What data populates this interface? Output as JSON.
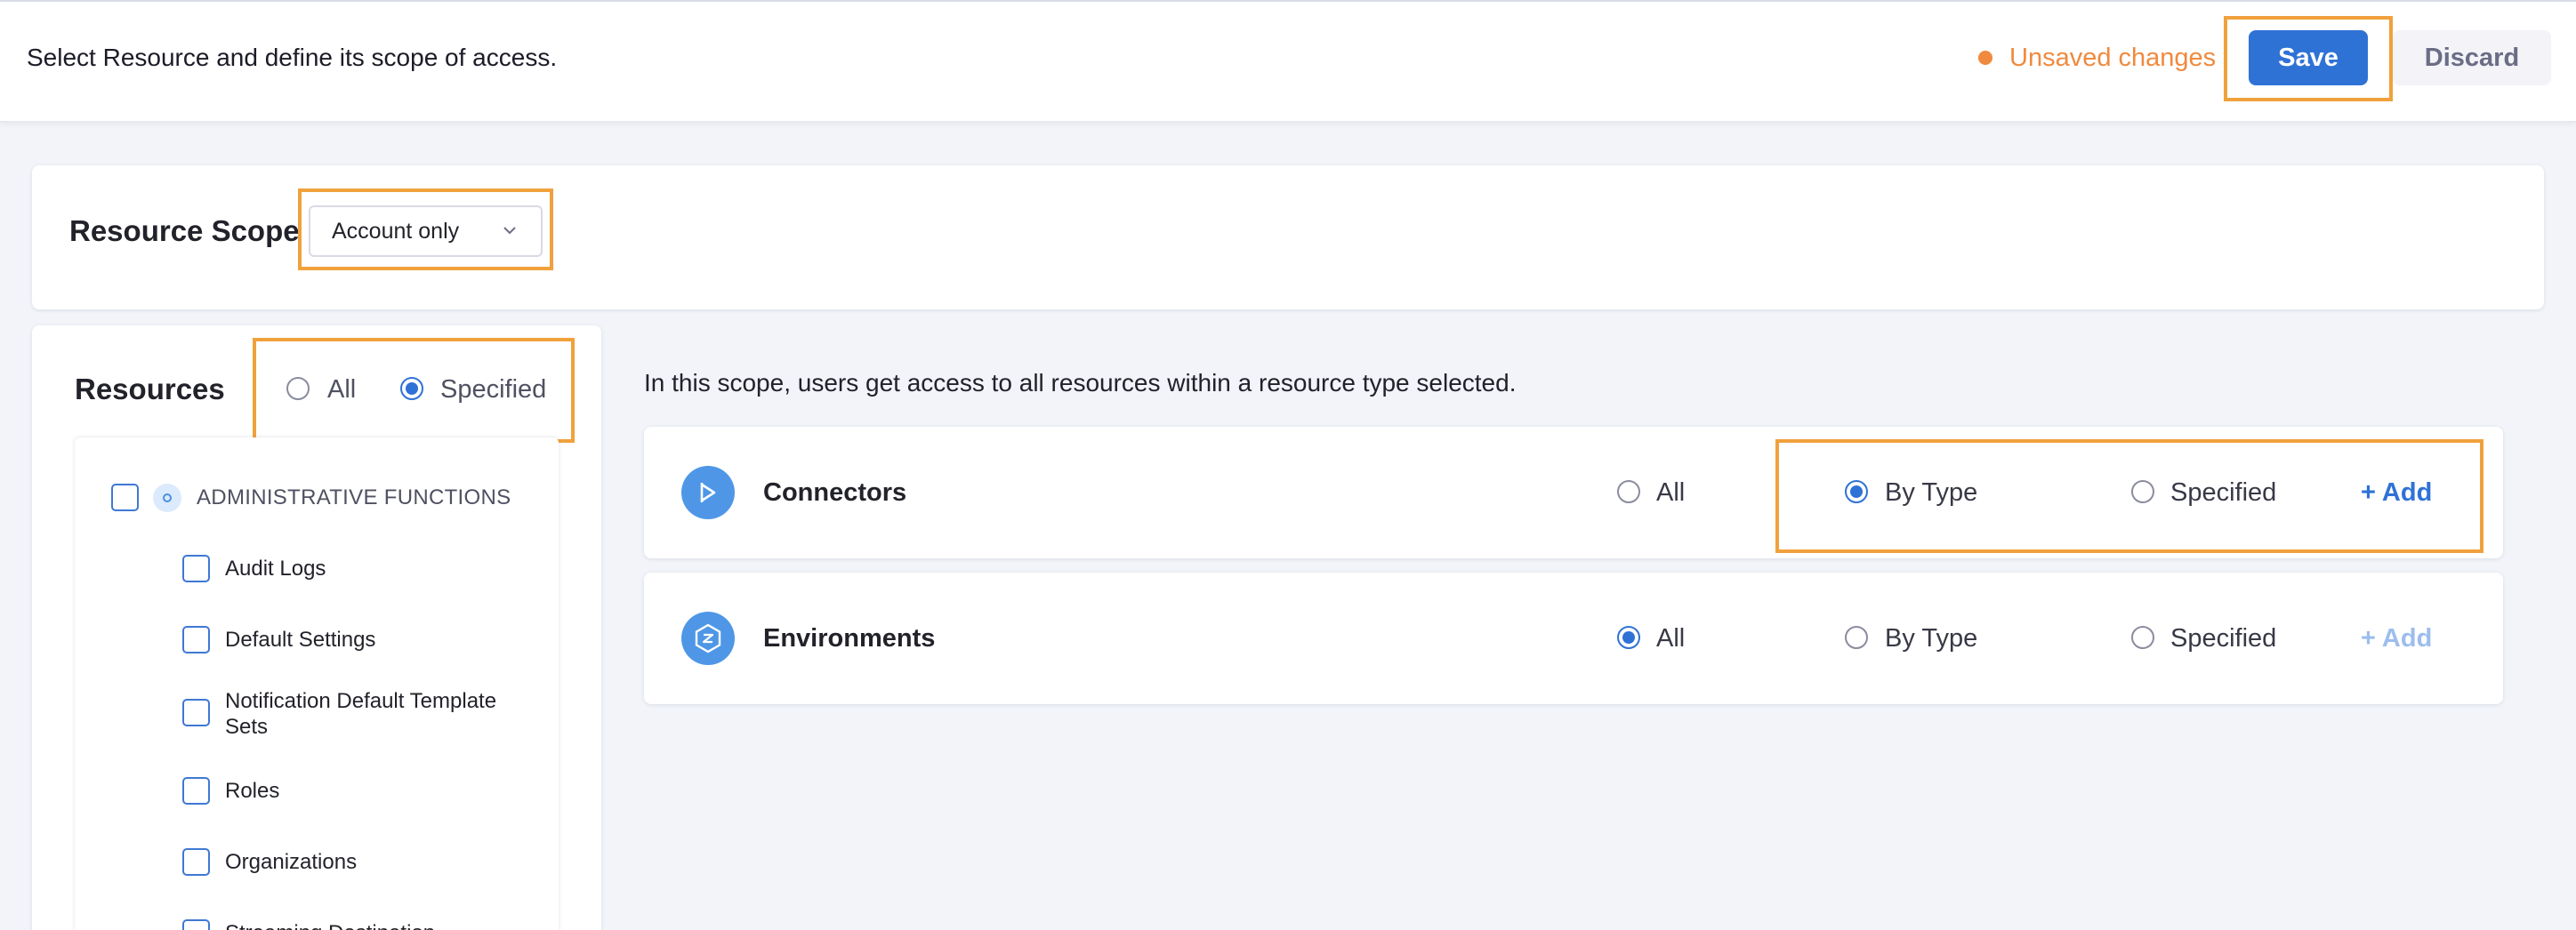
{
  "topbar": {
    "description": "Select Resource and define its scope of access.",
    "unsaved_label": "Unsaved changes",
    "save_label": "Save",
    "discard_label": "Discard"
  },
  "resource_scope": {
    "title": "Resource Scope",
    "selected": "Account only"
  },
  "resources": {
    "title": "Resources",
    "mode_options": [
      "All",
      "Specified"
    ],
    "selected_mode": "Specified",
    "tree": {
      "group_label": "ADMINISTRATIVE FUNCTIONS",
      "items": [
        {
          "label": "Audit Logs"
        },
        {
          "label": "Default Settings"
        },
        {
          "label": "Notification Default Template Sets"
        },
        {
          "label": "Roles"
        },
        {
          "label": "Organizations"
        },
        {
          "label": "Streaming Destination"
        }
      ]
    }
  },
  "scope_info": "In this scope, users get access to all resources within a resource type selected.",
  "resource_rows": [
    {
      "name": "Connectors",
      "options": [
        "All",
        "By Type",
        "Specified"
      ],
      "selected": "By Type",
      "add_label": "+ Add",
      "add_enabled": true
    },
    {
      "name": "Environments",
      "options": [
        "All",
        "By Type",
        "Specified"
      ],
      "selected": "All",
      "add_label": "+ Add",
      "add_enabled": false
    }
  ],
  "colors": {
    "accent": "#2f72d6",
    "warning": "#f08a3e",
    "highlight": "#f0a13c"
  }
}
